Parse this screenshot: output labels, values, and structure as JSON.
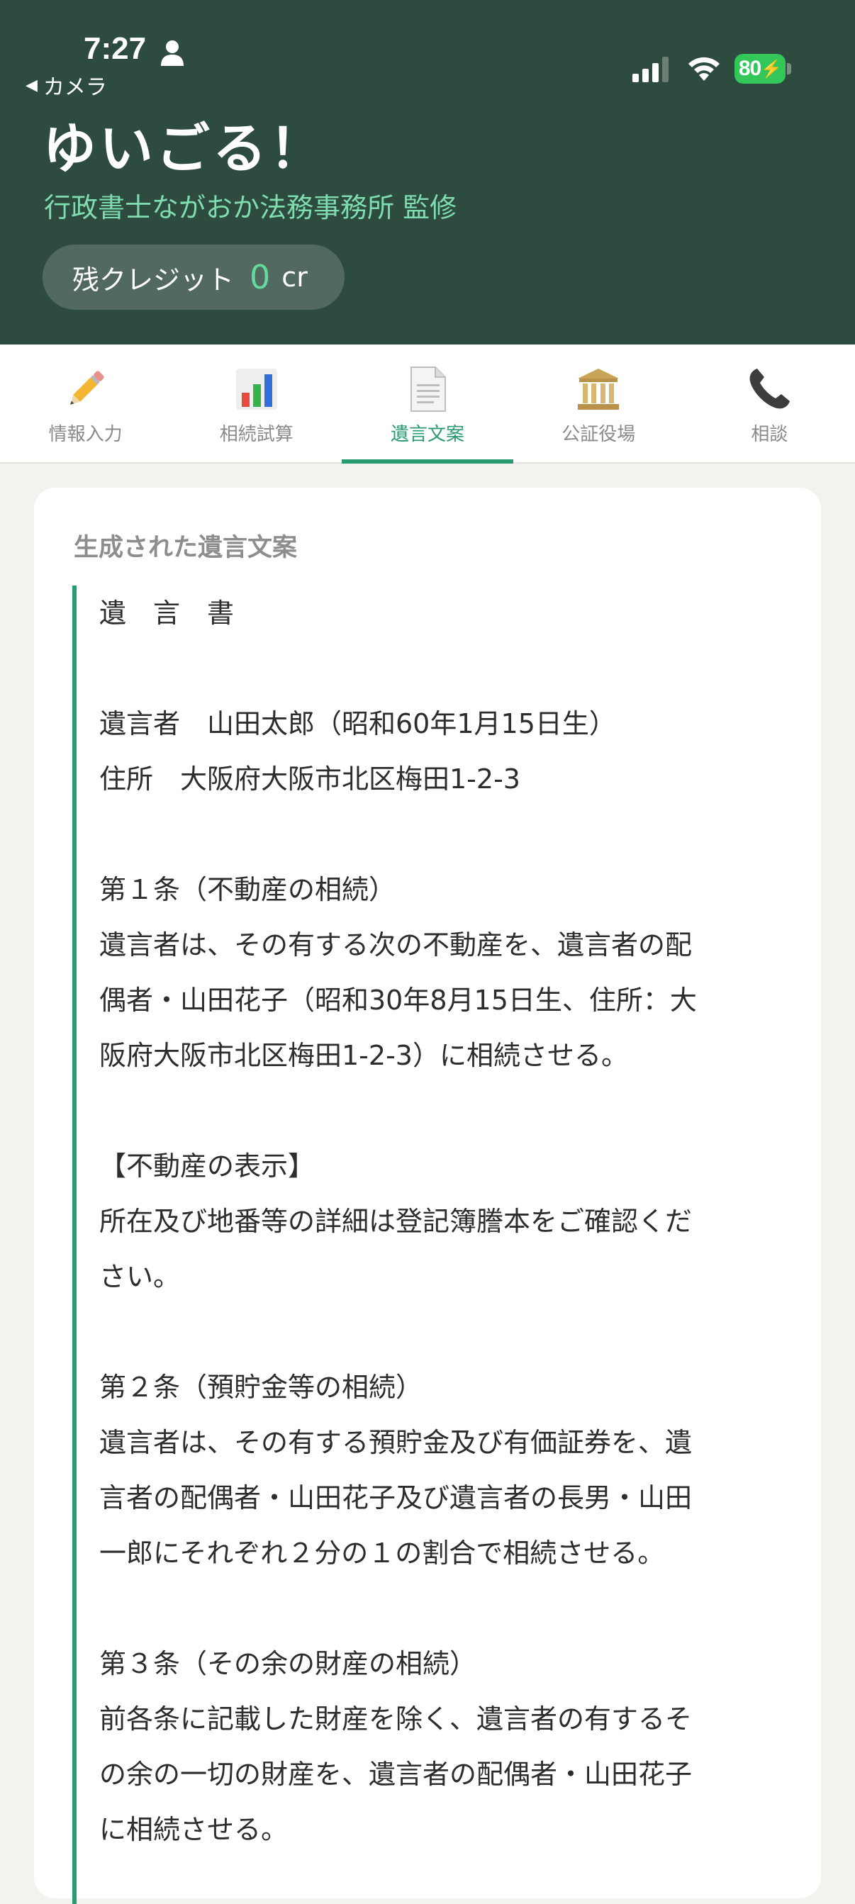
{
  "status_bar": {
    "time": "7:27",
    "back_label": "カメラ",
    "battery": "80"
  },
  "header": {
    "title": "ゆいごる！",
    "subtitle": "行政書士ながおか法務事務所 監修",
    "credit_label": "残クレジット",
    "credit_value": "0",
    "credit_unit": "cr"
  },
  "tabs": [
    {
      "label": "情報入力",
      "icon": "pencil-icon",
      "active": false
    },
    {
      "label": "相続試算",
      "icon": "bar-chart-icon",
      "active": false
    },
    {
      "label": "遺言文案",
      "icon": "document-icon",
      "active": true
    },
    {
      "label": "公証役場",
      "icon": "building-icon",
      "active": false
    },
    {
      "label": "相談",
      "icon": "phone-icon",
      "active": false
    }
  ],
  "card": {
    "title": "生成された遺言文案",
    "lines": [
      "遺　言　書",
      "",
      "遺言者　山田太郎（昭和60年1月15日生）",
      "住所　大阪府大阪市北区梅田1-2-3",
      "",
      "第１条（不動産の相続）",
      "遺言者は、その有する次の不動産を、遺言者の配",
      "偶者・山田花子（昭和30年8月15日生、住所：大",
      "阪府大阪市北区梅田1-2-3）に相続させる。",
      "",
      "【不動産の表示】",
      "所在及び地番等の詳細は登記簿謄本をご確認くだ",
      "さい。",
      "",
      "第２条（預貯金等の相続）",
      "遺言者は、その有する預貯金及び有価証券を、遺",
      "言者の配偶者・山田花子及び遺言者の長男・山田",
      "一郎にそれぞれ２分の１の割合で相続させる。",
      "",
      "第３条（その余の財産の相続）",
      "前各条に記載した財産を除く、遺言者の有するそ",
      "の余の一切の財産を、遺言者の配偶者・山田花子",
      "に相続させる。"
    ]
  },
  "colors": {
    "header_bg": "#2e4b40",
    "accent": "#2a9a70",
    "subtitle": "#7fdcae"
  }
}
